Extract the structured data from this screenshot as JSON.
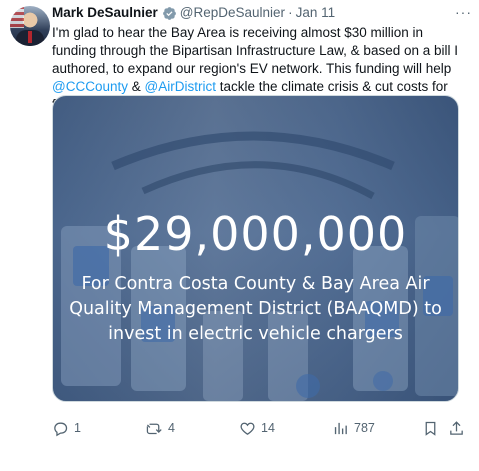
{
  "tweet": {
    "author_name": "Mark DeSaulnier",
    "handle": "@RepDeSaulnier",
    "date": "Jan 11",
    "more": "···",
    "text_parts": {
      "p1": "I'm glad to hear the Bay Area is receiving almost $30 million in funding through the Bipartisan Infrastructure Law, & based on a bill I authored, to expand our region's EV network. This funding will help ",
      "mention1": "@CCCounty",
      "p2": " & ",
      "mention2": "@AirDistrict",
      "p3": " tackle the climate crisis & cut costs for families."
    },
    "media": {
      "amount": "$29,000,000",
      "caption": "For Contra Costa County & Bay Area Air Quality Management District (BAAQMD) to invest in electric vehicle chargers"
    },
    "actions": {
      "replies": "1",
      "reposts": "4",
      "likes": "14",
      "views": "787"
    },
    "icons": {
      "verified": "verified-badge-icon",
      "reply": "reply-icon",
      "repost": "repost-icon",
      "like": "heart-icon",
      "views": "views-chart-icon",
      "bookmark": "bookmark-icon",
      "share": "share-icon"
    },
    "colors": {
      "link": "#1d9bf0",
      "muted": "#536471",
      "text": "#0f1419"
    }
  }
}
